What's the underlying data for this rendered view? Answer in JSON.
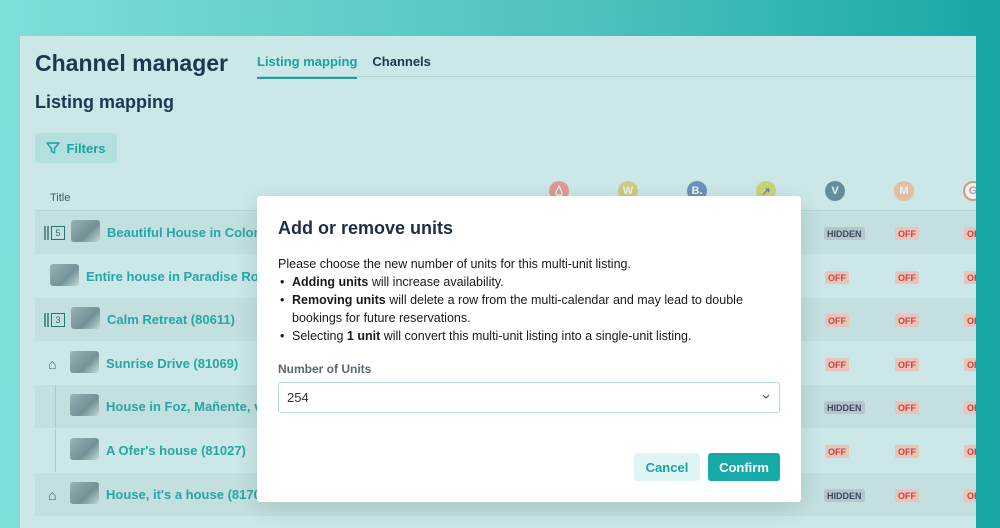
{
  "app": {
    "title": "Channel manager"
  },
  "tabs": [
    {
      "label": "Listing mapping",
      "active": true
    },
    {
      "label": "Channels",
      "active": false
    }
  ],
  "page": {
    "subtitle": "Listing mapping"
  },
  "toolbar": {
    "filters_label": "Filters"
  },
  "table": {
    "title_header": "Title",
    "channels": [
      {
        "icon": "airbnb-icon",
        "letter": "",
        "color": "#f25a5a"
      },
      {
        "icon": "w-channel-icon",
        "letter": "W",
        "color": "#d9b22b"
      },
      {
        "icon": "booking-icon",
        "letter": "B.",
        "color": "#1f4f8f"
      },
      {
        "icon": "arrow-channel-icon",
        "letter": "↗",
        "color": "#c8c423"
      },
      {
        "icon": "v-channel-icon",
        "letter": "V",
        "color": "#17425e"
      },
      {
        "icon": "m-channel-icon",
        "letter": "M",
        "color": "#f3a06a"
      },
      {
        "icon": "google-icon",
        "letter": "G",
        "color": "#e8503a"
      }
    ],
    "rows": [
      {
        "title": "Beautiful House in Colon",
        "units": "5",
        "status1": "HIDDEN",
        "status2": "OFF",
        "status3": "OF"
      },
      {
        "title": "Entire house in Paradise Roa",
        "units": "",
        "status1": "OFF",
        "status2": "OFF",
        "status3": "OF"
      },
      {
        "title": "Calm Retreat (80611)",
        "units": "3",
        "status1": "OFF",
        "status2": "OFF",
        "status3": "OF"
      },
      {
        "title": "Sunrise Drive (81069)",
        "units": "",
        "status1": "OFF",
        "status2": "OFF",
        "status3": "OF"
      },
      {
        "title": "House in Foz, Mañente, v",
        "units": "",
        "status1": "HIDDEN",
        "status2": "OFF",
        "status3": "OF"
      },
      {
        "title": "A Ofer's house (81027)",
        "units": "",
        "status1": "OFF",
        "status2": "OFF",
        "status3": "OF"
      },
      {
        "title": "House, it's a house (8170",
        "units": "",
        "status1": "HIDDEN",
        "status2": "OFF",
        "status3": "OF"
      }
    ]
  },
  "modal": {
    "title": "Add or remove units",
    "intro": "Please choose the new number of units for this multi-unit listing.",
    "bullet1_bold": "Adding units",
    "bullet1_rest": " will increase availability.",
    "bullet2_bold": "Removing units",
    "bullet2_rest": " will delete a row from the multi-calendar and may lead to double bookings for future reservations.",
    "bullet3_pre": "Selecting ",
    "bullet3_bold": "1 unit",
    "bullet3_rest": " will convert this multi-unit listing into a single-unit listing.",
    "field_label": "Number of Units",
    "field_value": "254",
    "cancel_label": "Cancel",
    "confirm_label": "Confirm"
  }
}
